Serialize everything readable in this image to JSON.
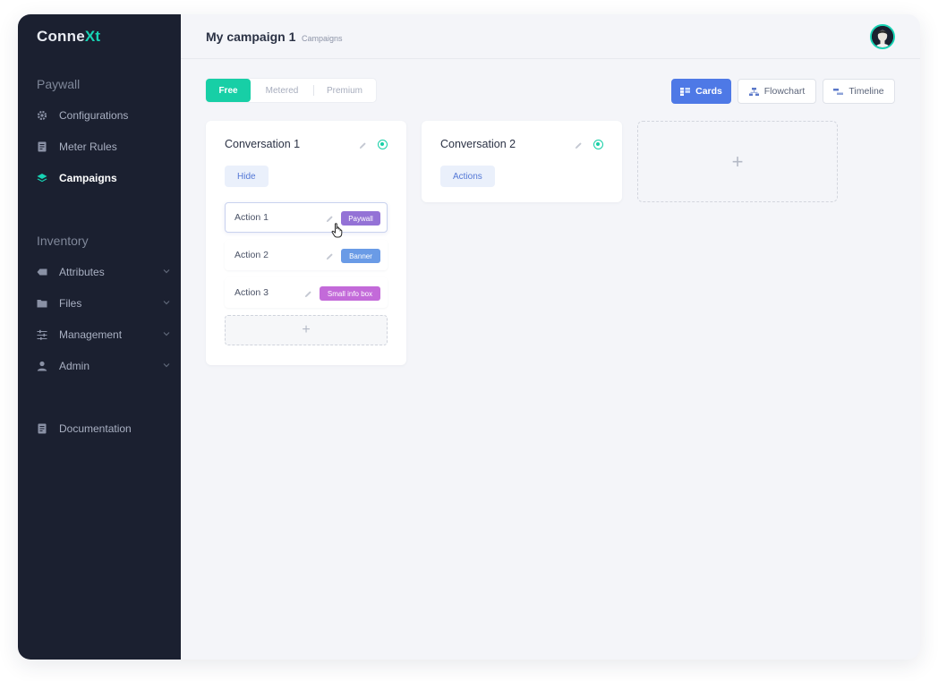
{
  "app": {
    "logo_main": "Conne",
    "logo_accent": "Xt"
  },
  "sidebar": {
    "section_paywall": "Paywall",
    "paywall_items": [
      {
        "label": "Configurations",
        "icon": "gear-icon"
      },
      {
        "label": "Meter Rules",
        "icon": "document-icon"
      },
      {
        "label": "Campaigns",
        "icon": "layers-icon",
        "active": true
      }
    ],
    "section_inventory": "Inventory",
    "inventory_items": [
      {
        "label": "Attributes",
        "icon": "tag-icon"
      },
      {
        "label": "Files",
        "icon": "folder-icon"
      },
      {
        "label": "Management",
        "icon": "sliders-icon"
      },
      {
        "label": "Admin",
        "icon": "user-icon"
      }
    ],
    "documentation": {
      "label": "Documentation",
      "icon": "document-icon"
    }
  },
  "header": {
    "title": "My campaign 1",
    "breadcrumb": "Campaigns"
  },
  "tiers": {
    "options": [
      "Free",
      "Metered",
      "Premium"
    ],
    "selected": "Free"
  },
  "views": {
    "cards": "Cards",
    "flowchart": "Flowchart",
    "timeline": "Timeline",
    "selected": "Cards"
  },
  "conversations": [
    {
      "title": "Conversation 1",
      "button_label": "Hide",
      "active": true,
      "actions": [
        {
          "label": "Action 1",
          "tag": "Paywall",
          "tag_color": "#9472d6"
        },
        {
          "label": "Action 2",
          "tag": "Banner",
          "tag_color": "#6a9be6"
        },
        {
          "label": "Action 3",
          "tag": "Small info box",
          "tag_color": "#c36ad9"
        }
      ],
      "add_action_label": "+"
    },
    {
      "title": "Conversation 2",
      "button_label": "Actions",
      "active": true
    }
  ],
  "add_conversation_label": "+",
  "colors": {
    "accent": "#17cfa6",
    "primary": "#4e79e6",
    "sidebar_bg": "#1b2030"
  }
}
